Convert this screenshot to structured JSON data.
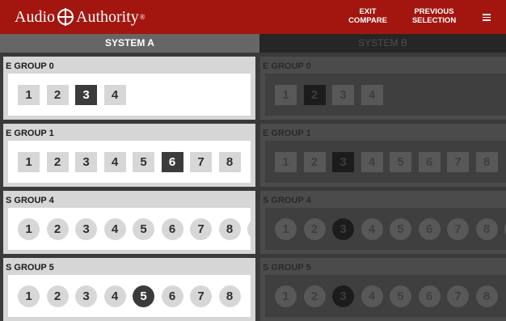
{
  "header": {
    "brand_left": "Audio",
    "brand_right": "Authority",
    "brand_reg": "®",
    "exit_compare": [
      "EXIT",
      "COMPARE"
    ],
    "previous_selection": [
      "PREVIOUS",
      "SELECTION"
    ],
    "menu_icon": "hamburger-menu-icon",
    "bg_color": "#a3160f"
  },
  "tabs": {
    "system_a": "SYSTEM A",
    "system_b": "SYSTEM B",
    "active": "system_a"
  },
  "system_a": {
    "groups": [
      {
        "title": "E GROUP 0",
        "shape": "square",
        "buttons": [
          "1",
          "2",
          "3",
          "4"
        ],
        "active": "3"
      },
      {
        "title": "E GROUP 1",
        "shape": "square",
        "buttons": [
          "1",
          "2",
          "3",
          "4",
          "5",
          "6",
          "7",
          "8"
        ],
        "active": "6"
      },
      {
        "title": "S GROUP 4",
        "shape": "round",
        "buttons": [
          "1",
          "2",
          "3",
          "4",
          "5",
          "6",
          "7",
          "8",
          ""
        ],
        "active": null
      },
      {
        "title": "S GROUP 5",
        "shape": "round",
        "buttons": [
          "1",
          "2",
          "3",
          "4",
          "5",
          "6",
          "7",
          "8"
        ],
        "active": "5"
      }
    ]
  },
  "system_b": {
    "groups": [
      {
        "title": "E GROUP 0",
        "shape": "square",
        "buttons": [
          "1",
          "2",
          "3",
          "4"
        ],
        "active": "2"
      },
      {
        "title": "E GROUP 1",
        "shape": "square",
        "buttons": [
          "1",
          "2",
          "3",
          "4",
          "5",
          "6",
          "7",
          "8"
        ],
        "active": "3"
      },
      {
        "title": "S GROUP 4",
        "shape": "round",
        "buttons": [
          "1",
          "2",
          "3",
          "4",
          "5",
          "6",
          "7",
          "8",
          ""
        ],
        "active": "3"
      },
      {
        "title": "S GROUP 5",
        "shape": "round",
        "buttons": [
          "1",
          "2",
          "3",
          "4",
          "5",
          "6",
          "7",
          "8"
        ],
        "active": "3"
      }
    ]
  }
}
